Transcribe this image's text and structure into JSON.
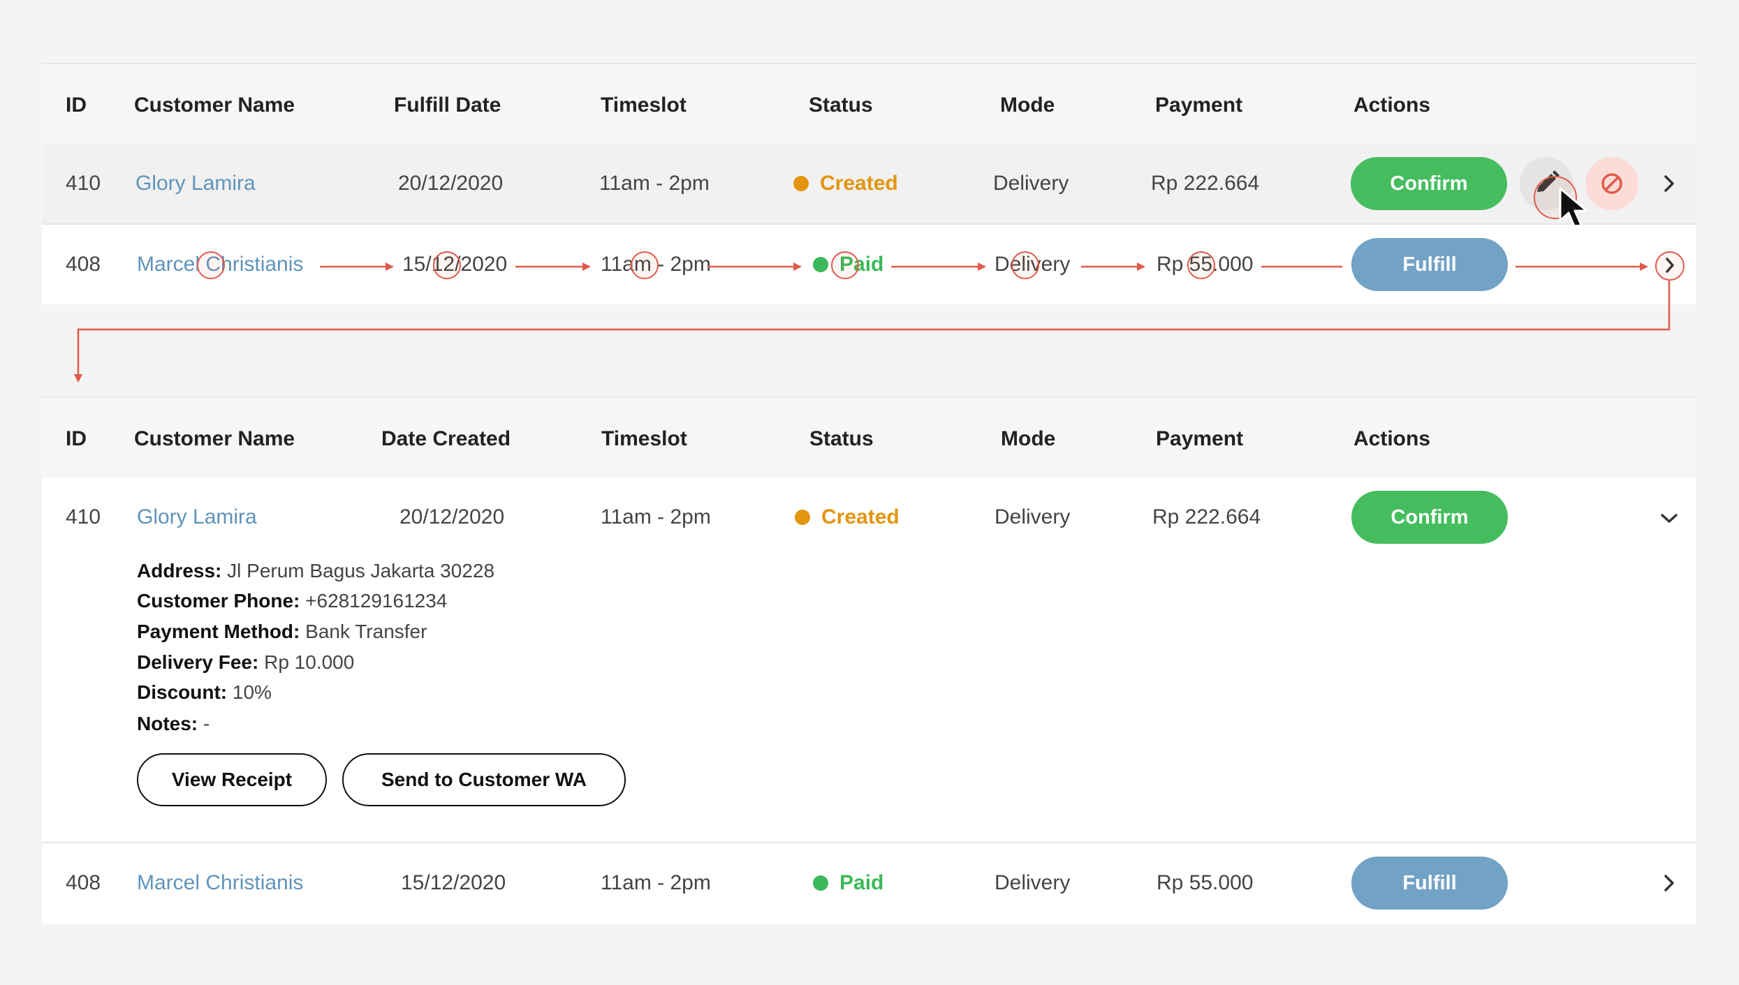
{
  "table1": {
    "headers": [
      "ID",
      "Customer Name",
      "Fulfill Date",
      "Timeslot",
      "Status",
      "Mode",
      "Payment",
      "Actions"
    ],
    "rows": [
      {
        "id": "410",
        "name": "Glory Lamira",
        "date": "20/12/2020",
        "timeslot": "11am - 2pm",
        "status": "Created",
        "mode": "Delivery",
        "payment": "Rp 222.664",
        "action": "Confirm"
      },
      {
        "id": "408",
        "name": "Marcel Christianis",
        "date": "15/12/2020",
        "timeslot": "11am - 2pm",
        "status": "Paid",
        "mode": "Delivery",
        "payment": "Rp 55.000",
        "action": "Fulfill"
      }
    ]
  },
  "table2": {
    "headers": [
      "ID",
      "Customer Name",
      "Date Created",
      "Timeslot",
      "Status",
      "Mode",
      "Payment",
      "Actions"
    ],
    "rows": [
      {
        "id": "410",
        "name": "Glory Lamira",
        "date": "20/12/2020",
        "timeslot": "11am - 2pm",
        "status": "Created",
        "mode": "Delivery",
        "payment": "Rp 222.664",
        "action": "Confirm"
      },
      {
        "id": "408",
        "name": "Marcel Christianis",
        "date": "15/12/2020",
        "timeslot": "11am - 2pm",
        "status": "Paid",
        "mode": "Delivery",
        "payment": "Rp 55.000",
        "action": "Fulfill"
      }
    ],
    "details": [
      {
        "label": "Address:",
        "value": "Jl Perum Bagus Jakarta 30228"
      },
      {
        "label": "Customer Phone:",
        "value": "+628129161234"
      },
      {
        "label": "Payment Method:",
        "value": "Bank Transfer"
      },
      {
        "label": "Delivery Fee:",
        "value": "Rp 10.000"
      },
      {
        "label": "Discount:",
        "value": "10%"
      },
      {
        "label": "Notes:",
        "value": "-"
      }
    ],
    "buttons": {
      "view_receipt": "View Receipt",
      "send_wa": "Send to Customer WA"
    }
  },
  "colors": {
    "confirm": "#45bd5f",
    "fulfill": "#72a2c5",
    "created": "#e3950f",
    "paid": "#3cb85a",
    "name_link": "#5f93ba",
    "annotation": "#e05a4a",
    "cancel_bg": "#fddcd7"
  },
  "icons": [
    "pencil-icon",
    "cancel-icon",
    "chevron-right-icon",
    "chevron-down-icon",
    "cursor-pointer-icon"
  ]
}
